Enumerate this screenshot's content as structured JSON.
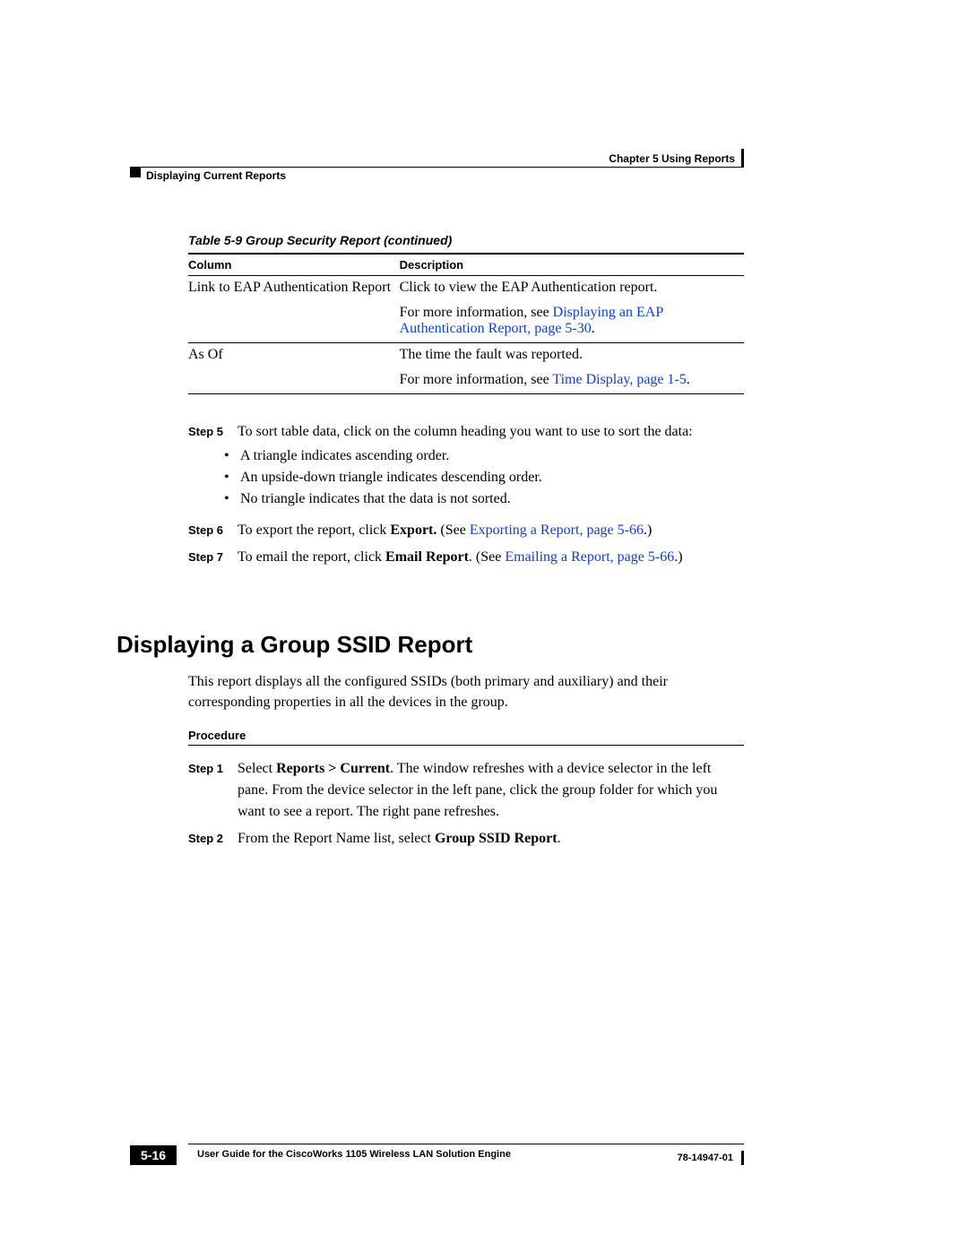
{
  "header": {
    "chapter": "Chapter 5      Using Reports",
    "section": "Displaying Current Reports"
  },
  "table": {
    "caption": "Table 5-9    Group Security Report  (continued)",
    "col1": "Column",
    "col2": "Description",
    "rows": [
      {
        "c1": "Link to EAP Authentication Report",
        "c2a": "Click to view the EAP Authentication report.",
        "c2b_pre": "For more information, see ",
        "c2b_link": "Displaying an EAP Authentication Report, page 5-30",
        "c2b_post": "."
      },
      {
        "c1": "As Of",
        "c2a": "The time the fault was reported.",
        "c2b_pre": "For more information, see ",
        "c2b_link": "Time Display, page 1-5",
        "c2b_post": "."
      }
    ]
  },
  "steps1": {
    "s5label": "Step 5",
    "s5text": "To sort table data, click on the column heading you want to use to sort the data:",
    "b1": "A triangle indicates ascending order.",
    "b2": "An upside-down triangle indicates descending order.",
    "b3": "No triangle indicates that the data is not sorted.",
    "s6label": "Step 6",
    "s6_pre": "To export the report, click ",
    "s6_bold": "Export.",
    "s6_mid": " (See ",
    "s6_link": "Exporting a Report, page 5-66",
    "s6_post": ".)",
    "s7label": "Step 7",
    "s7_pre": "To email the report, click ",
    "s7_bold": "Email Report",
    "s7_mid": ". (See ",
    "s7_link": "Emailing a Report, page 5-66",
    "s7_post": ".)"
  },
  "section2": {
    "heading": "Displaying a Group SSID Report",
    "intro": "This report displays all the configured SSIDs (both primary and auxiliary) and their corresponding properties in all the devices in the group.",
    "proc": "Procedure",
    "s1label": "Step 1",
    "s1_a": "Select ",
    "s1_bold": "Reports > Current",
    "s1_b": ". The window refreshes with a device selector in the left pane. From the device selector in the left pane, click the group folder for which you want to see a report. The right pane refreshes.",
    "s2label": "Step 2",
    "s2_a": "From the Report Name list, select ",
    "s2_bold": "Group SSID Report",
    "s2_b": "."
  },
  "footer": {
    "title": "User Guide for the CiscoWorks 1105 Wireless LAN Solution Engine",
    "page": "5-16",
    "docid": "78-14947-01"
  }
}
